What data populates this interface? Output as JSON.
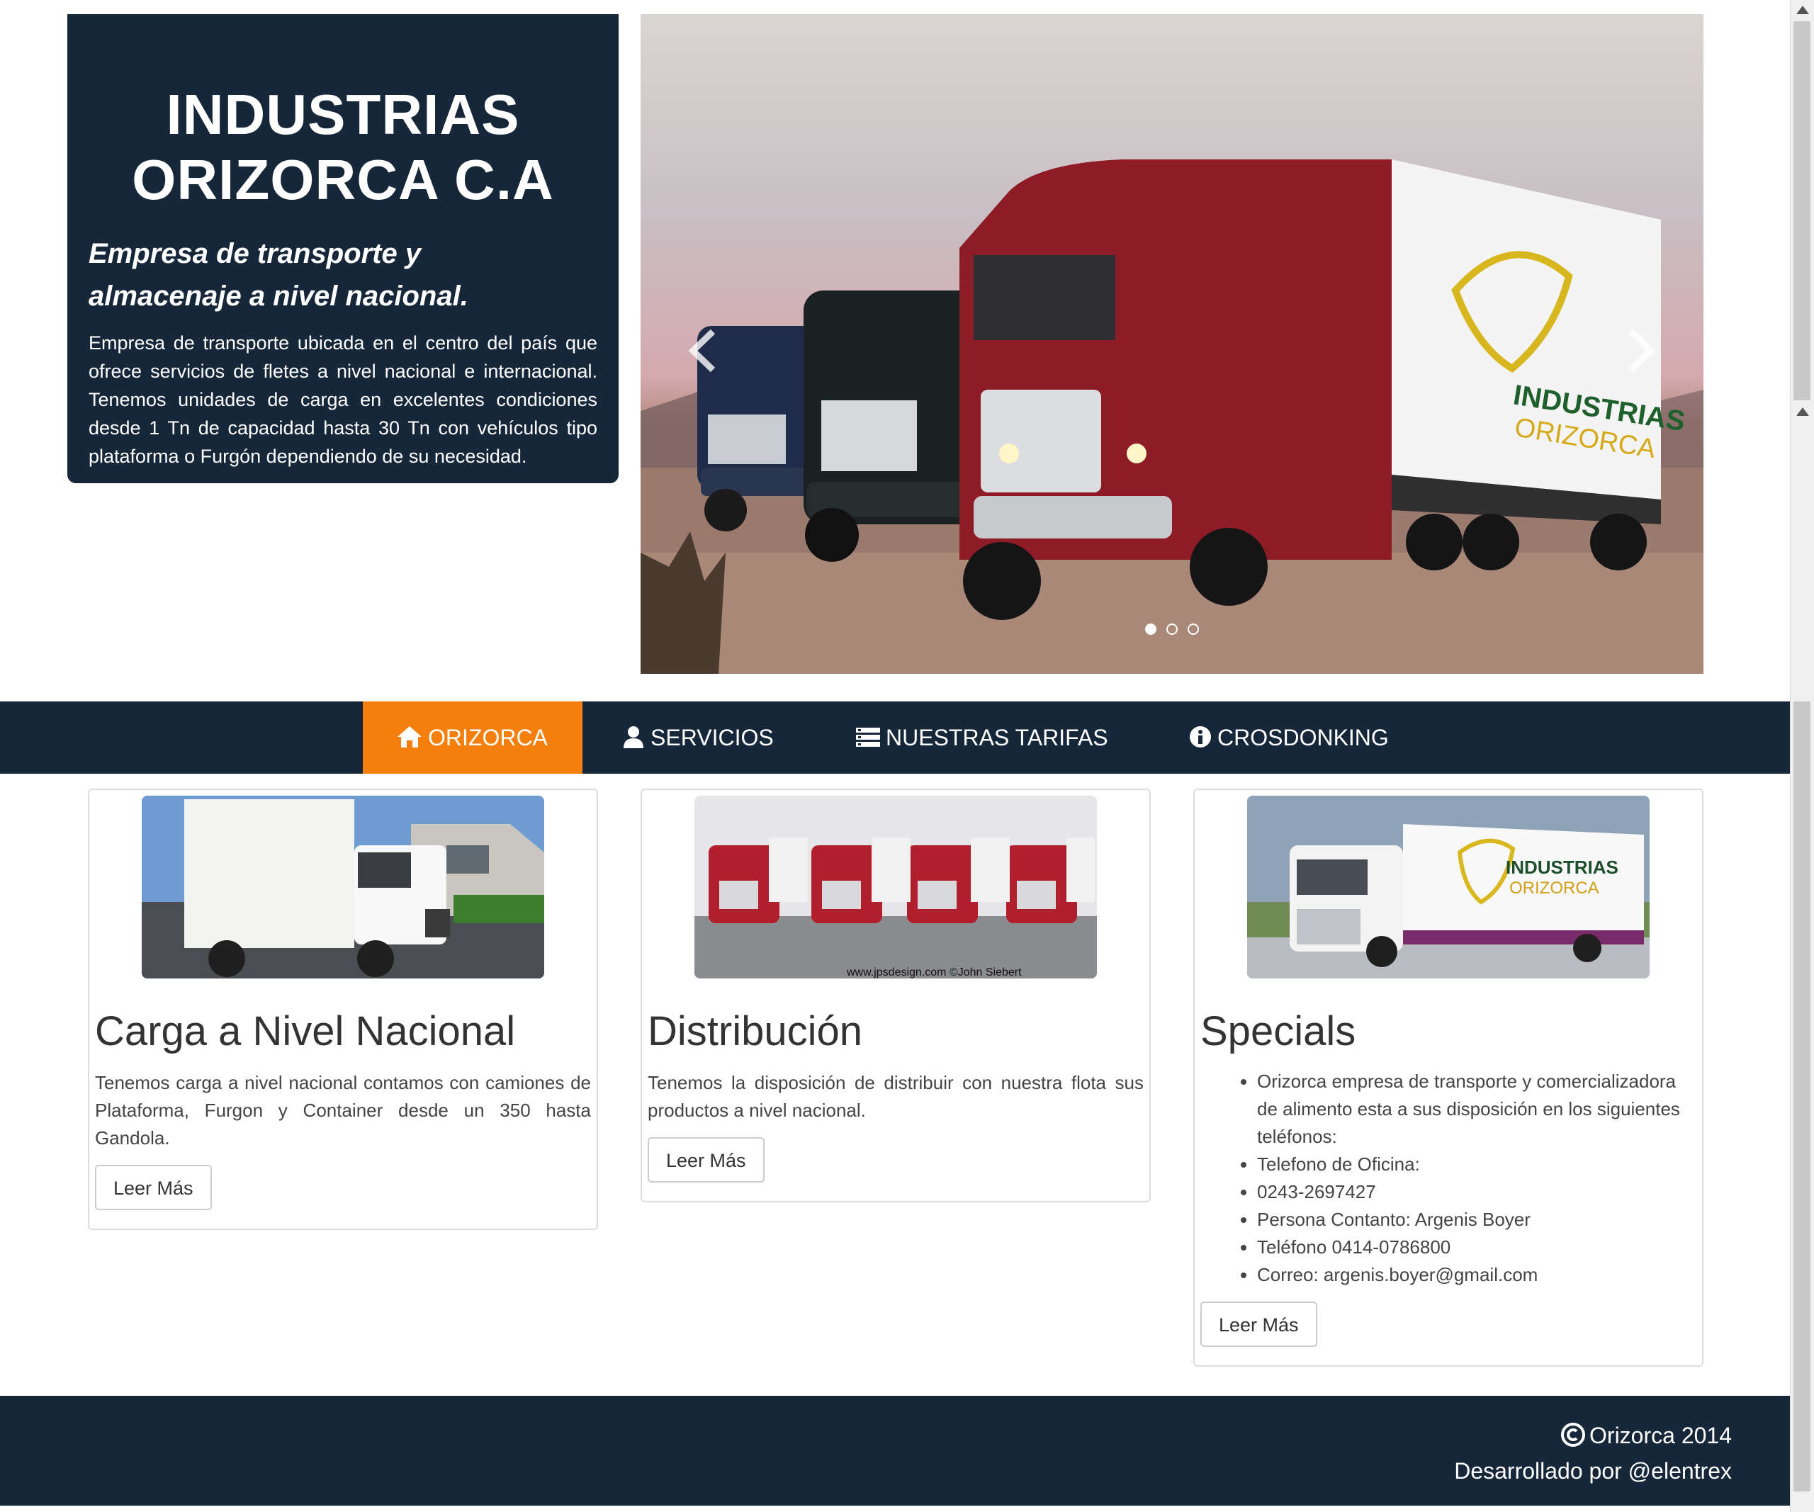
{
  "hero": {
    "title_line1": "INDUSTRIAS",
    "title_line2": "ORIZORCA C.A",
    "subtitle_line1": "Empresa de transporte y",
    "subtitle_line2": "almacenaje a nivel nacional.",
    "description": "Empresa de transporte ubicada en el centro del país que ofrece servicios de fletes a nivel nacional e internacional. Tenemos unidades de carga en excelentes condiciones desde 1 Tn de capacidad hasta 30 Tn con vehículos tipo plataforma o Furgón dependiendo de su necesidad."
  },
  "carousel": {
    "trailer_logo_line1": "INDUSTRIAS",
    "trailer_logo_line2": "ORIZORCA",
    "active_slide": 1,
    "slide_count": 3,
    "prev_icon": "chevron-left-icon",
    "next_icon": "chevron-right-icon"
  },
  "nav": {
    "items": [
      {
        "label": "ORIZORCA",
        "icon": "home-icon",
        "active": true
      },
      {
        "label": "SERVICIOS",
        "icon": "user-icon",
        "active": false
      },
      {
        "label": "NUESTRAS TARIFAS",
        "icon": "list-icon",
        "active": false
      },
      {
        "label": "CROSDONKING",
        "icon": "info-icon",
        "active": false
      }
    ],
    "active_color": "#f57f0d",
    "background": "#17273a"
  },
  "cards": [
    {
      "title": "Carga a Nivel Nacional",
      "text": "Tenemos carga a nivel nacional contamos con camiones de Plataforma, Furgon y Container desde un 350 hasta Gandola.",
      "button": "Leer Más"
    },
    {
      "title": "Distribución",
      "text": "Tenemos la disposición de distribuir con nuestra flota sus productos a nivel nacional.",
      "image_caption": "www.jpsdesign.com ©John Siebert",
      "button": "Leer Más"
    },
    {
      "title": "Specials",
      "list": [
        "Orizorca empresa de transporte y comercializadora de alimento esta a sus disposición en los siguientes teléfonos:",
        "Telefono de Oficina:",
        "0243-2697427",
        "Persona Contanto: Argenis Boyer",
        "Teléfono 0414-0786800",
        "Correo: argenis.boyer@gmail.com"
      ],
      "image_logo_line1": "INDUSTRIAS",
      "image_logo_line2": "ORIZORCA",
      "button": "Leer Más"
    }
  ],
  "footer": {
    "copyright": "Orizorca 2014",
    "credit": "Desarrollado por @elentrex"
  }
}
